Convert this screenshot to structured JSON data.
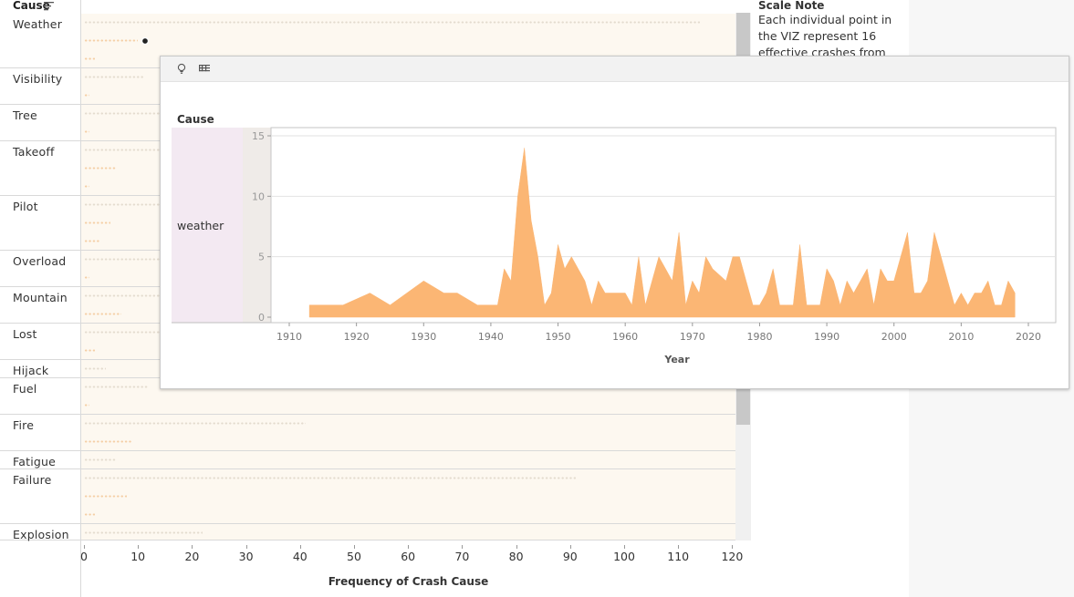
{
  "main_view": {
    "header": "Cause",
    "axis_title": "Frequency of Crash Cause",
    "x_ticks": [
      "0",
      "10",
      "20",
      "30",
      "40",
      "50",
      "60",
      "70",
      "80",
      "90",
      "100",
      "110",
      "120"
    ],
    "rows": [
      {
        "label": "Weather",
        "h": 60,
        "lines": [
          [
            0,
            114,
            "g"
          ],
          [
            0,
            10,
            "o"
          ],
          [
            0,
            2,
            "o"
          ]
        ]
      },
      {
        "label": "Visibility",
        "h": 40,
        "lines": [
          [
            0,
            11,
            "g"
          ],
          [
            0,
            1,
            "o"
          ]
        ]
      },
      {
        "label": "Tree",
        "h": 40,
        "lines": [
          [
            0,
            14,
            "g"
          ],
          [
            0,
            1,
            "o"
          ]
        ]
      },
      {
        "label": "Takeoff",
        "h": 60,
        "lines": [
          [
            0,
            14,
            "g"
          ],
          [
            0,
            6,
            "o"
          ],
          [
            0,
            1,
            "o"
          ]
        ]
      },
      {
        "label": "Pilot",
        "h": 60,
        "lines": [
          [
            0,
            14,
            "g"
          ],
          [
            0,
            5,
            "o"
          ],
          [
            0,
            3,
            "o"
          ]
        ]
      },
      {
        "label": "Overload",
        "h": 40,
        "lines": [
          [
            0,
            14,
            "g"
          ],
          [
            0,
            1,
            "o"
          ]
        ]
      },
      {
        "label": "Mountain",
        "h": 40,
        "lines": [
          [
            0,
            14,
            "g"
          ],
          [
            0,
            7,
            "o"
          ]
        ]
      },
      {
        "label": "Lost",
        "h": 40,
        "lines": [
          [
            0,
            14,
            "g"
          ],
          [
            0,
            2,
            "o"
          ]
        ]
      },
      {
        "label": "Hijack",
        "h": 20,
        "lines": [
          [
            0,
            4,
            "g"
          ]
        ]
      },
      {
        "label": "Fuel",
        "h": 40,
        "lines": [
          [
            0,
            12,
            "g"
          ],
          [
            0,
            1,
            "o"
          ]
        ]
      },
      {
        "label": "Fire",
        "h": 40,
        "lines": [
          [
            0,
            41,
            "g"
          ],
          [
            0,
            9,
            "o"
          ]
        ]
      },
      {
        "label": "Fatigue",
        "h": 20,
        "lines": [
          [
            0,
            6,
            "g"
          ]
        ]
      },
      {
        "label": "Failure",
        "h": 60,
        "lines": [
          [
            0,
            91,
            "g"
          ],
          [
            0,
            8,
            "o"
          ],
          [
            0,
            2,
            "o"
          ]
        ]
      },
      {
        "label": "Explosion",
        "h": 18,
        "lines": [
          [
            0,
            22,
            "g"
          ]
        ]
      }
    ]
  },
  "scale_note": {
    "title": "Scale Note",
    "text": "Each individual point in the VIZ represent 16 effective crashes from"
  },
  "tooltip": {
    "column_header": "Cause",
    "row_label": "weather",
    "x_title": "Year"
  },
  "chart_data": [
    {
      "type": "scatter",
      "title": "",
      "xlabel": "Frequency of Crash Cause",
      "ylabel": "Cause",
      "xlim": [
        0,
        120
      ],
      "categories": [
        "Weather",
        "Visibility",
        "Tree",
        "Takeoff",
        "Pilot",
        "Overload",
        "Mountain",
        "Lost",
        "Hijack",
        "Fuel",
        "Fire",
        "Fatigue",
        "Failure",
        "Explosion"
      ],
      "highlight": {
        "category": "Weather",
        "x": 12
      }
    },
    {
      "type": "area",
      "series": [
        {
          "name": "weather",
          "x": [
            1913,
            1914,
            1918,
            1922,
            1925,
            1930,
            1933,
            1935,
            1938,
            1941,
            1942,
            1943,
            1944,
            1945,
            1946,
            1947,
            1948,
            1949,
            1950,
            1951,
            1952,
            1953,
            1954,
            1955,
            1956,
            1957,
            1960,
            1961,
            1962,
            1963,
            1964,
            1965,
            1966,
            1967,
            1968,
            1969,
            1970,
            1971,
            1972,
            1973,
            1975,
            1976,
            1977,
            1978,
            1979,
            1980,
            1981,
            1982,
            1983,
            1984,
            1985,
            1986,
            1987,
            1989,
            1990,
            1991,
            1992,
            1993,
            1994,
            1995,
            1996,
            1997,
            1998,
            1999,
            2000,
            2001,
            2002,
            2003,
            2004,
            2005,
            2006,
            2007,
            2008,
            2009,
            2010,
            2011,
            2012,
            2013,
            2014,
            2015,
            2016,
            2017,
            2018
          ],
          "values": [
            1,
            1,
            1,
            2,
            1,
            3,
            2,
            2,
            1,
            1,
            4,
            3,
            10,
            14,
            8,
            5,
            1,
            2,
            6,
            4,
            5,
            4,
            3,
            1,
            3,
            2,
            2,
            1,
            5,
            1,
            3,
            5,
            4,
            3,
            7,
            1,
            3,
            2,
            5,
            4,
            3,
            5,
            5,
            3,
            1,
            1,
            2,
            4,
            1,
            1,
            1,
            6,
            1,
            1,
            4,
            3,
            1,
            3,
            2,
            3,
            4,
            1,
            4,
            3,
            3,
            5,
            7,
            2,
            2,
            3,
            7,
            5,
            3,
            1,
            2,
            1,
            2,
            2,
            3,
            1,
            1,
            3,
            2
          ]
        }
      ],
      "xlabel": "Year",
      "ylabel": "",
      "xlim": [
        1905,
        2022
      ],
      "ylim": [
        0,
        15
      ],
      "x_ticks": [
        1910,
        1920,
        1930,
        1940,
        1950,
        1960,
        1970,
        1980,
        1990,
        2000,
        2010,
        2020
      ],
      "y_ticks": [
        0,
        5,
        10,
        15
      ],
      "color": "#fbb674"
    }
  ],
  "colors": {
    "band": "#fdf8f0",
    "dot_gray": "#e4dccf",
    "dot_orange": "#f5cfa6",
    "area": "#fbb674",
    "header_fill": "#f3e9f2",
    "header_fill2": "#efebe8"
  },
  "icons": [
    "sort-icon",
    "lightbulb-icon",
    "data-list-icon",
    "selected-point-icon"
  ]
}
